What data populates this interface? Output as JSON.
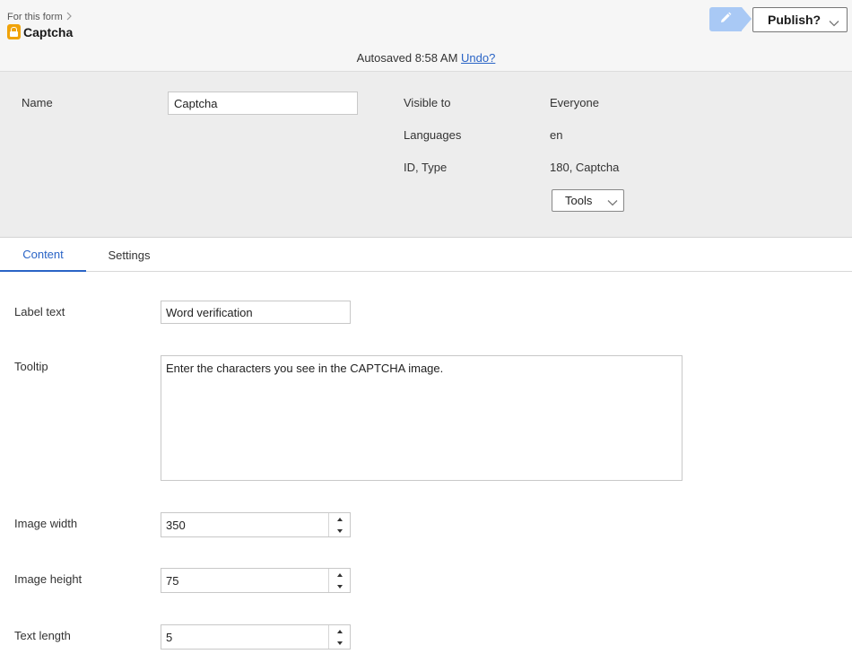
{
  "header": {
    "breadcrumb": "For this form",
    "title": "Captcha",
    "publish_label": "Publish?",
    "autosaved_text": "Autosaved 8:58 AM",
    "undo_label": "Undo?"
  },
  "properties": {
    "name_label": "Name",
    "name_value": "Captcha",
    "visible_to_label": "Visible to",
    "visible_to_value": "Everyone",
    "languages_label": "Languages",
    "languages_value": "en",
    "id_type_label": "ID, Type",
    "id_type_value": "180, Captcha",
    "tools_label": "Tools"
  },
  "tabs": [
    {
      "label": "Content",
      "active": true
    },
    {
      "label": "Settings",
      "active": false
    }
  ],
  "form": {
    "label_text_label": "Label text",
    "label_text_value": "Word verification",
    "tooltip_label": "Tooltip",
    "tooltip_value": "Enter the characters you see in the CAPTCHA image.",
    "image_width_label": "Image width",
    "image_width_value": "350",
    "image_height_label": "Image height",
    "image_height_value": "75",
    "text_length_label": "Text length",
    "text_length_value": "5"
  },
  "colors": {
    "accent": "#2a64c6",
    "lock_icon": "#f0a30a",
    "edit_button": "#a9c9f5"
  },
  "icons": {
    "breadcrumb_chevron": "chevron-right-icon",
    "title_icon": "lock-icon",
    "edit": "pencil-icon",
    "dropdown": "chevron-down-icon",
    "spinner_up": "caret-up-icon",
    "spinner_down": "caret-down-icon"
  }
}
